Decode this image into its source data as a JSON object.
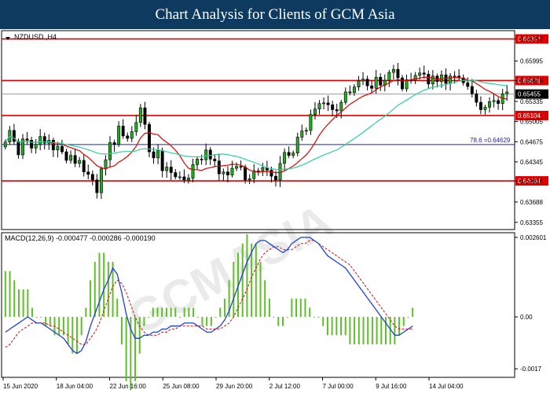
{
  "header": {
    "title": "Chart Analysis for Clients of GCM Asia"
  },
  "chart_data": [
    {
      "type": "candlestick",
      "symbol_label": "NZDUSD.,H4",
      "ylim": [
        0.6325,
        0.6648
      ],
      "y_ticks": [
        "0.63355",
        "0.63688",
        "0.64034",
        "0.64345",
        "0.64675",
        "0.65005",
        "0.65335",
        "0.65676",
        "0.65995",
        "0.66357"
      ],
      "highlighted_levels": [
        {
          "label": "0.66357",
          "value": 0.66357,
          "color": "#e00000"
        },
        {
          "label": "0.65676",
          "value": 0.65676,
          "color": "#e00000"
        },
        {
          "label": "0.65104",
          "value": 0.65104,
          "color": "#e00000"
        },
        {
          "label": "0.64034",
          "value": 0.64034,
          "color": "#e00000"
        }
      ],
      "current_price": {
        "label": "0.65455",
        "value": 0.65455
      },
      "fib_line": {
        "label": "78.6 =0.64629",
        "value": 0.64629,
        "color": "#2020c0"
      },
      "x_labels": [
        "15 Jun 2020",
        "18 Jun 04:00",
        "22 Jun 16:00",
        "25 Jun 08:00",
        "29 Jun 20:00",
        "2 Jul 12:00",
        "7 Jul 00:00",
        "9 Jul 16:00",
        "14 Jul 04:00"
      ],
      "close": [
        0.6467,
        0.6486,
        0.6468,
        0.6446,
        0.6472,
        0.647,
        0.6457,
        0.6463,
        0.6476,
        0.6465,
        0.647,
        0.6454,
        0.646,
        0.6451,
        0.6437,
        0.6445,
        0.6432,
        0.6437,
        0.6418,
        0.6414,
        0.6405,
        0.6384,
        0.6423,
        0.6438,
        0.6466,
        0.6463,
        0.6493,
        0.6477,
        0.6473,
        0.6484,
        0.6499,
        0.6523,
        0.6496,
        0.6451,
        0.6441,
        0.6453,
        0.642,
        0.6426,
        0.6417,
        0.641,
        0.641,
        0.6405,
        0.6408,
        0.643,
        0.6439,
        0.6438,
        0.6454,
        0.6439,
        0.6436,
        0.6415,
        0.6418,
        0.6413,
        0.6424,
        0.6427,
        0.6426,
        0.6405,
        0.6407,
        0.642,
        0.642,
        0.6425,
        0.6421,
        0.6411,
        0.6405,
        0.6432,
        0.645,
        0.6445,
        0.6449,
        0.6475,
        0.6485,
        0.6486,
        0.6512,
        0.6521,
        0.653,
        0.6531,
        0.6528,
        0.652,
        0.6518,
        0.6532,
        0.6549,
        0.6548,
        0.6557,
        0.6567,
        0.657,
        0.6559,
        0.6555,
        0.6573,
        0.656,
        0.6568,
        0.6581,
        0.6586,
        0.6572,
        0.6554,
        0.6569,
        0.6568,
        0.6576,
        0.658,
        0.6578,
        0.6562,
        0.6575,
        0.6566,
        0.6577,
        0.6563,
        0.6575,
        0.6575,
        0.6572,
        0.6564,
        0.6558,
        0.6546,
        0.6532,
        0.652,
        0.6524,
        0.6533,
        0.6535,
        0.653,
        0.6546,
        0.6549
      ]
    },
    {
      "type": "macd",
      "label": "MACD(12,26,9) -0.000477 -0.000286 -0.000190",
      "y_ticks": [
        "0.002601",
        "0.00",
        "-0.0017"
      ],
      "ylim": [
        -0.00185,
        0.0026
      ],
      "macd": [
        -0.0005,
        -0.0004,
        -0.0003,
        -0.0002,
        -0.0001,
        0.0,
        -0.0001,
        -0.0002,
        -0.0002,
        -0.0003,
        -0.0004,
        -0.0005,
        -0.0006,
        -0.0007,
        -0.0009,
        -0.0011,
        -0.0012,
        -0.0011,
        -0.0008,
        -0.0003,
        0.0001,
        0.0005,
        0.0009,
        0.0012,
        0.0016,
        0.0014,
        0.0008,
        0.0001,
        -0.0004,
        -0.0007,
        -0.0007,
        -0.0006,
        -0.0006,
        -0.0005,
        -0.0005,
        -0.0004,
        -0.0004,
        -0.0003,
        -0.0003,
        -0.0003,
        -0.0002,
        -0.0002,
        -0.0002,
        -0.0003,
        -0.0004,
        -0.0005,
        -0.0005,
        -0.0004,
        -0.0003,
        -0.0001,
        0.0002,
        0.0006,
        0.001,
        0.0014,
        0.0018,
        0.0021,
        0.0024,
        0.0025,
        0.0025,
        0.0024,
        0.0023,
        0.0022,
        0.0021,
        0.0022,
        0.0024,
        0.0025,
        0.0026,
        0.0026,
        0.0026,
        0.0025,
        0.0024,
        0.0022,
        0.002,
        0.0019,
        0.0018,
        0.0017,
        0.0016,
        0.0014,
        0.0012,
        0.001,
        0.0008,
        0.0006,
        0.0004,
        0.0002,
        0.0,
        -0.0002,
        -0.0004,
        -0.0006,
        -0.0006,
        -0.0005,
        -0.0004,
        -0.0003
      ],
      "signal": [
        -0.001,
        -0.0009,
        -0.0007,
        -0.0005,
        -0.0004,
        -0.0003,
        -0.0002,
        -0.0002,
        -0.0002,
        -0.0002,
        -0.0003,
        -0.0003,
        -0.0004,
        -0.0005,
        -0.0006,
        -0.0007,
        -0.0008,
        -0.0009,
        -0.0009,
        -0.0007,
        -0.0005,
        -0.0002,
        0.0002,
        0.0006,
        0.001,
        0.0012,
        0.0011,
        0.0008,
        0.0004,
        0.0,
        -0.0003,
        -0.0005,
        -0.0006,
        -0.0006,
        -0.0006,
        -0.0005,
        -0.0005,
        -0.0004,
        -0.0004,
        -0.0003,
        -0.0003,
        -0.0003,
        -0.0003,
        -0.0003,
        -0.0003,
        -0.0004,
        -0.0004,
        -0.0004,
        -0.0004,
        -0.0003,
        -0.0002,
        0.0,
        0.0003,
        0.0006,
        0.0009,
        0.0013,
        0.0016,
        0.0019,
        0.0021,
        0.0022,
        0.0023,
        0.0023,
        0.0022,
        0.0022,
        0.0022,
        0.0023,
        0.0024,
        0.0024,
        0.0025,
        0.0025,
        0.0024,
        0.0023,
        0.0022,
        0.0021,
        0.002,
        0.0019,
        0.0018,
        0.0017,
        0.0015,
        0.0013,
        0.0011,
        0.0009,
        0.0007,
        0.0005,
        0.0003,
        0.0001,
        -0.0001,
        -0.0003,
        -0.0004,
        -0.0004,
        -0.0004,
        -0.0004
      ]
    }
  ],
  "colors": {
    "banner": "#0f3a5f",
    "sma_fast": "#e00000",
    "sma_slow": "#2ed09a",
    "macd": "#1f3fd6",
    "signal": "#d01010",
    "histogram": "#5fbf2b"
  }
}
